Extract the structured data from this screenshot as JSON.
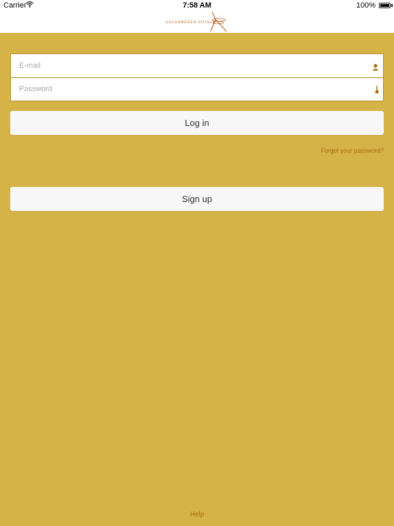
{
  "status_bar": {
    "carrier": "Carrier",
    "time": "7:58 AM",
    "battery": "100%",
    "wifi_icon": "wifi-icon",
    "battery_icon": "battery-icon"
  },
  "header": {
    "logo_text": "GULDSMEDEN HOTELS",
    "logo_icon": "dragonfly-icon"
  },
  "login_form": {
    "email_placeholder": "E-mail",
    "email_value": "",
    "email_icon": "user-icon",
    "password_placeholder": "Password",
    "password_value": "",
    "password_icon": "key-icon",
    "login_label": "Log in",
    "forgot_label": "Forgot your password?",
    "signup_label": "Sign up"
  },
  "footer": {
    "help_label": "Help"
  },
  "colors": {
    "background": "#d6b347",
    "accent": "#a86a10",
    "button": "#f7f7f7",
    "logo": "#c0692a"
  }
}
